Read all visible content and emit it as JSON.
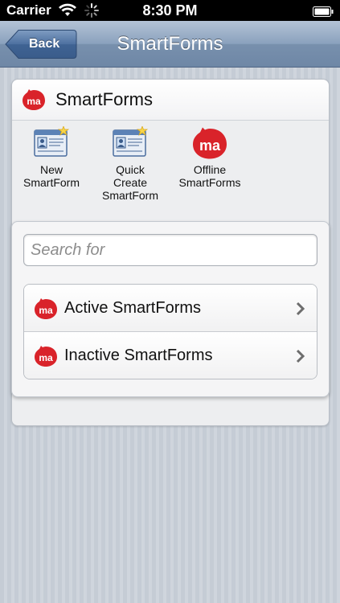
{
  "status_bar": {
    "carrier": "Carrier",
    "time": "8:30 PM"
  },
  "nav": {
    "back_label": "Back",
    "title": "SmartForms"
  },
  "panel": {
    "title": "SmartForms",
    "actions": [
      {
        "line1": "New",
        "line2": "SmartForm",
        "line3": ""
      },
      {
        "line1": "Quick",
        "line2": "Create",
        "line3": "SmartForm"
      },
      {
        "line1": "Offline",
        "line2": "SmartForms",
        "line3": ""
      }
    ]
  },
  "search": {
    "placeholder": "Search for"
  },
  "list": {
    "items": [
      {
        "label": "Active SmartForms"
      },
      {
        "label": "Inactive SmartForms"
      }
    ]
  },
  "colors": {
    "brand_red": "#d9232a",
    "nav_blue": "#8aa1bd"
  },
  "icons": [
    "wifi-icon",
    "activity-spinner-icon",
    "battery-icon",
    "back-arrow-icon",
    "ma-logo-icon",
    "form-card-icon",
    "chevron-right-icon"
  ]
}
